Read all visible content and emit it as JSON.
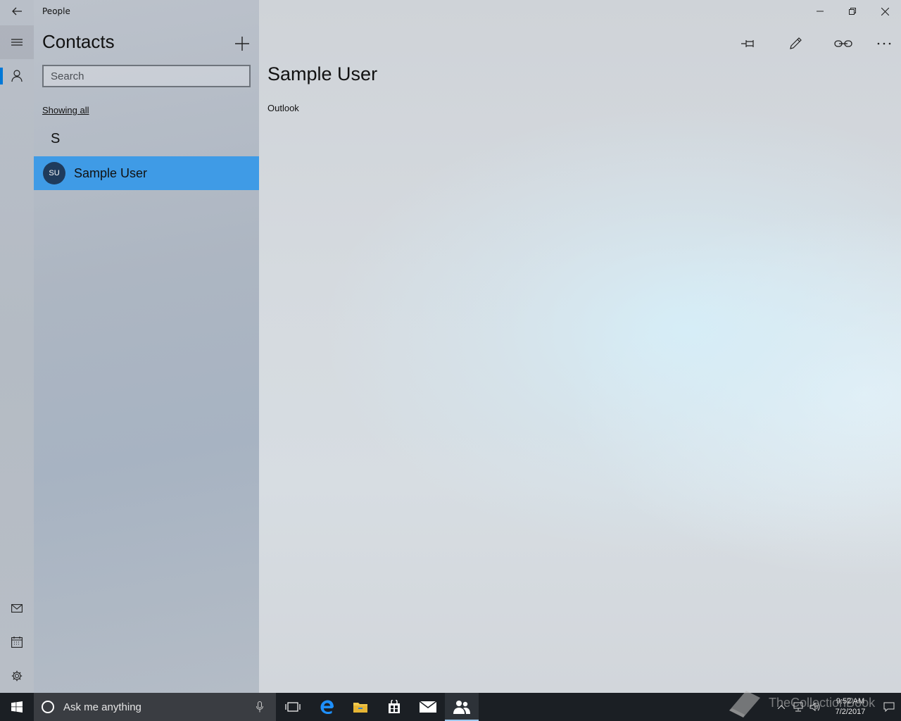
{
  "window": {
    "title": "People",
    "controls": [
      "minimize",
      "restore",
      "close"
    ]
  },
  "rail": {
    "items": [
      {
        "name": "hamburger-menu",
        "icon": "hamburger-icon"
      },
      {
        "name": "contacts",
        "icon": "person-icon",
        "active": true
      },
      {
        "name": "mail",
        "icon": "mail-icon"
      },
      {
        "name": "calendar",
        "icon": "calendar-icon"
      },
      {
        "name": "settings",
        "icon": "gear-icon"
      }
    ]
  },
  "list": {
    "title": "Contacts",
    "search_placeholder": "Search",
    "filter_label": "Showing all",
    "groups": [
      {
        "letter": "S",
        "contacts": [
          {
            "initials": "SU",
            "name": "Sample User",
            "selected": true
          }
        ]
      }
    ]
  },
  "detail": {
    "name": "Sample User",
    "source": "Outlook",
    "commands": [
      "pin-icon",
      "edit-icon",
      "link-icon",
      "more-icon"
    ]
  },
  "taskbar": {
    "search_placeholder": "Ask me anything",
    "apps": [
      "task-view-icon",
      "edge-icon",
      "file-explorer-icon",
      "store-icon",
      "mail-icon",
      "people-icon"
    ],
    "active_app": "people-icon",
    "time": "9:52 AM",
    "date": "7/2/2017"
  },
  "watermark": {
    "text": "TheCollectionBook"
  },
  "colors": {
    "accent": "#0078d7",
    "selection": "#3f9be6",
    "avatar_bg": "#1f3b5c",
    "taskbar": "#1b1f24"
  }
}
